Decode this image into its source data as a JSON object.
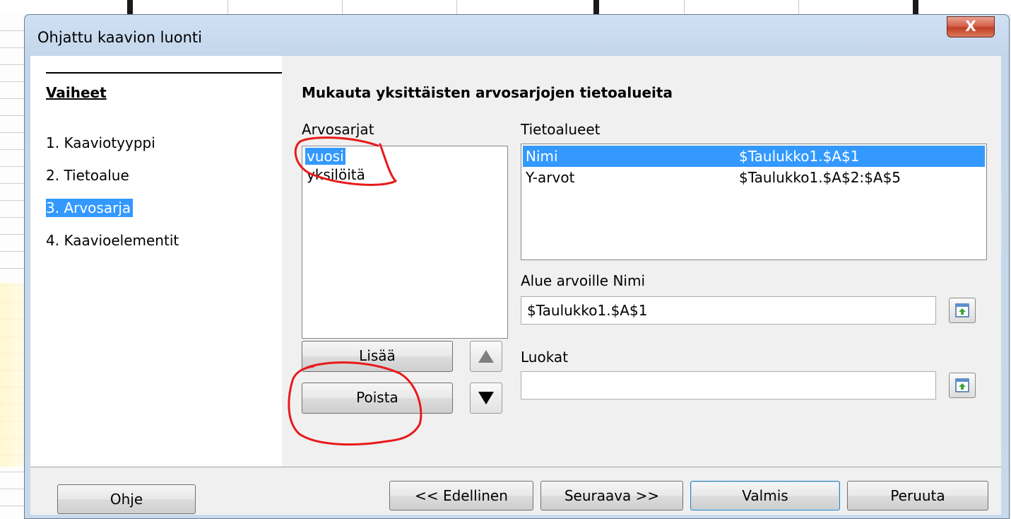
{
  "window": {
    "title": "Ohjattu kaavion luonti",
    "close_label": "X"
  },
  "steps": {
    "heading": "Vaiheet",
    "items": [
      {
        "label": "1. Kaaviotyyppi"
      },
      {
        "label": "2. Tietoalue"
      },
      {
        "label": "3. Arvosarja",
        "active": true
      },
      {
        "label": "4. Kaavioelementit"
      }
    ]
  },
  "main": {
    "title": "Mukauta yksittäisten arvosarjojen tietoalueita",
    "series": {
      "label": "Arvosarjat",
      "items": [
        "vuosi",
        "yksilöitä"
      ],
      "selected": "vuosi"
    },
    "ranges": {
      "label": "Tietoalueet",
      "rows": [
        {
          "name": "Nimi",
          "range": "$Taulukko1.$A$1"
        },
        {
          "name": "Y-arvot",
          "range": "$Taulukko1.$A$2:$A$5"
        }
      ]
    },
    "name_range": {
      "label": "Alue arvoille Nimi",
      "value": "$Taulukko1.$A$1"
    },
    "categories": {
      "label": "Luokat",
      "value": ""
    },
    "add_label": "Lisää",
    "remove_label": "Poista"
  },
  "buttons": {
    "help": "Ohje",
    "back": "<< Edellinen",
    "next": "Seuraava >>",
    "finish": "Valmis",
    "cancel": "Peruuta"
  },
  "colors": {
    "selection": "#3399ff",
    "annotation": "#e8191b"
  }
}
